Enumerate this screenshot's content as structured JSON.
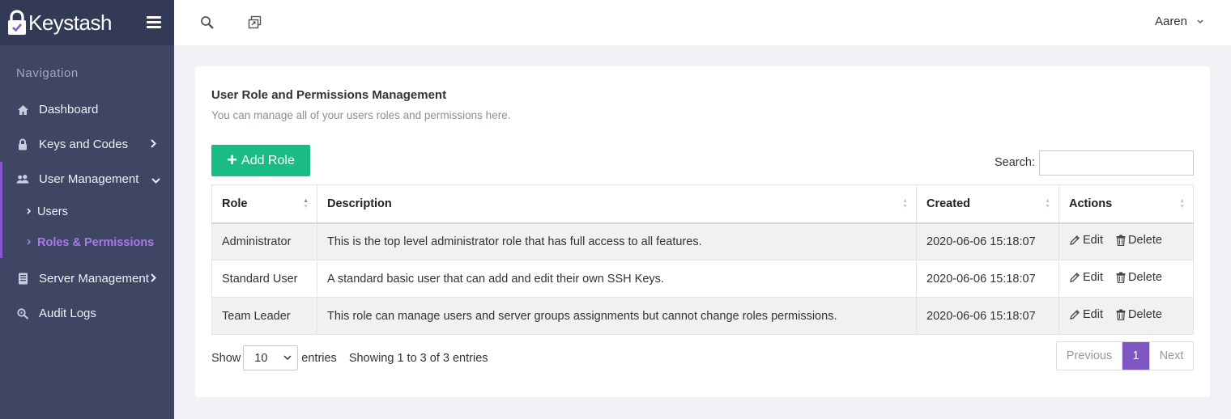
{
  "brand": {
    "name": "Keystash",
    "accent": "#8a55d0"
  },
  "sidebar": {
    "heading": "Navigation",
    "items": [
      {
        "label": "Dashboard",
        "icon": "home-icon"
      },
      {
        "label": "Keys and Codes",
        "icon": "lock-icon",
        "has_children": true
      },
      {
        "label": "User Management",
        "icon": "users-icon",
        "expanded": true,
        "children": [
          {
            "label": "Users"
          },
          {
            "label": "Roles & Permissions",
            "active": true
          }
        ]
      },
      {
        "label": "Server Management",
        "icon": "server-icon",
        "has_children": true
      },
      {
        "label": "Audit Logs",
        "icon": "audit-search-icon"
      }
    ]
  },
  "topbar": {
    "user": "Aaren"
  },
  "card": {
    "title": "User Role and Permissions Management",
    "subtitle": "You can manage all of your users roles and permissions here.",
    "add_button": "Add Role",
    "search_label": "Search:",
    "search_value": ""
  },
  "table": {
    "columns": [
      "Role",
      "Description",
      "Created",
      "Actions"
    ],
    "rows": [
      {
        "role": "Administrator",
        "description": "This is the top level administrator role that has full access to all features.",
        "created": "2020-06-06 15:18:07"
      },
      {
        "role": "Standard User",
        "description": "A standard basic user that can add and edit their own SSH Keys.",
        "created": "2020-06-06 15:18:07"
      },
      {
        "role": "Team Leader",
        "description": "This role can manage users and server groups assignments but cannot change roles permissions.",
        "created": "2020-06-06 15:18:07"
      }
    ],
    "action_edit": "Edit",
    "action_delete": "Delete"
  },
  "footer": {
    "show_label": "Show",
    "page_length": "10",
    "entries_label": "entries",
    "info": "Showing 1 to 3 of 3 entries",
    "prev": "Previous",
    "current_page": "1",
    "next": "Next"
  },
  "colors": {
    "sidebar": "#3f4663",
    "brand_bar": "#333a55",
    "add_button": "#1bbc83",
    "pager_active": "#7e57c2",
    "active_link": "#a779e9"
  }
}
